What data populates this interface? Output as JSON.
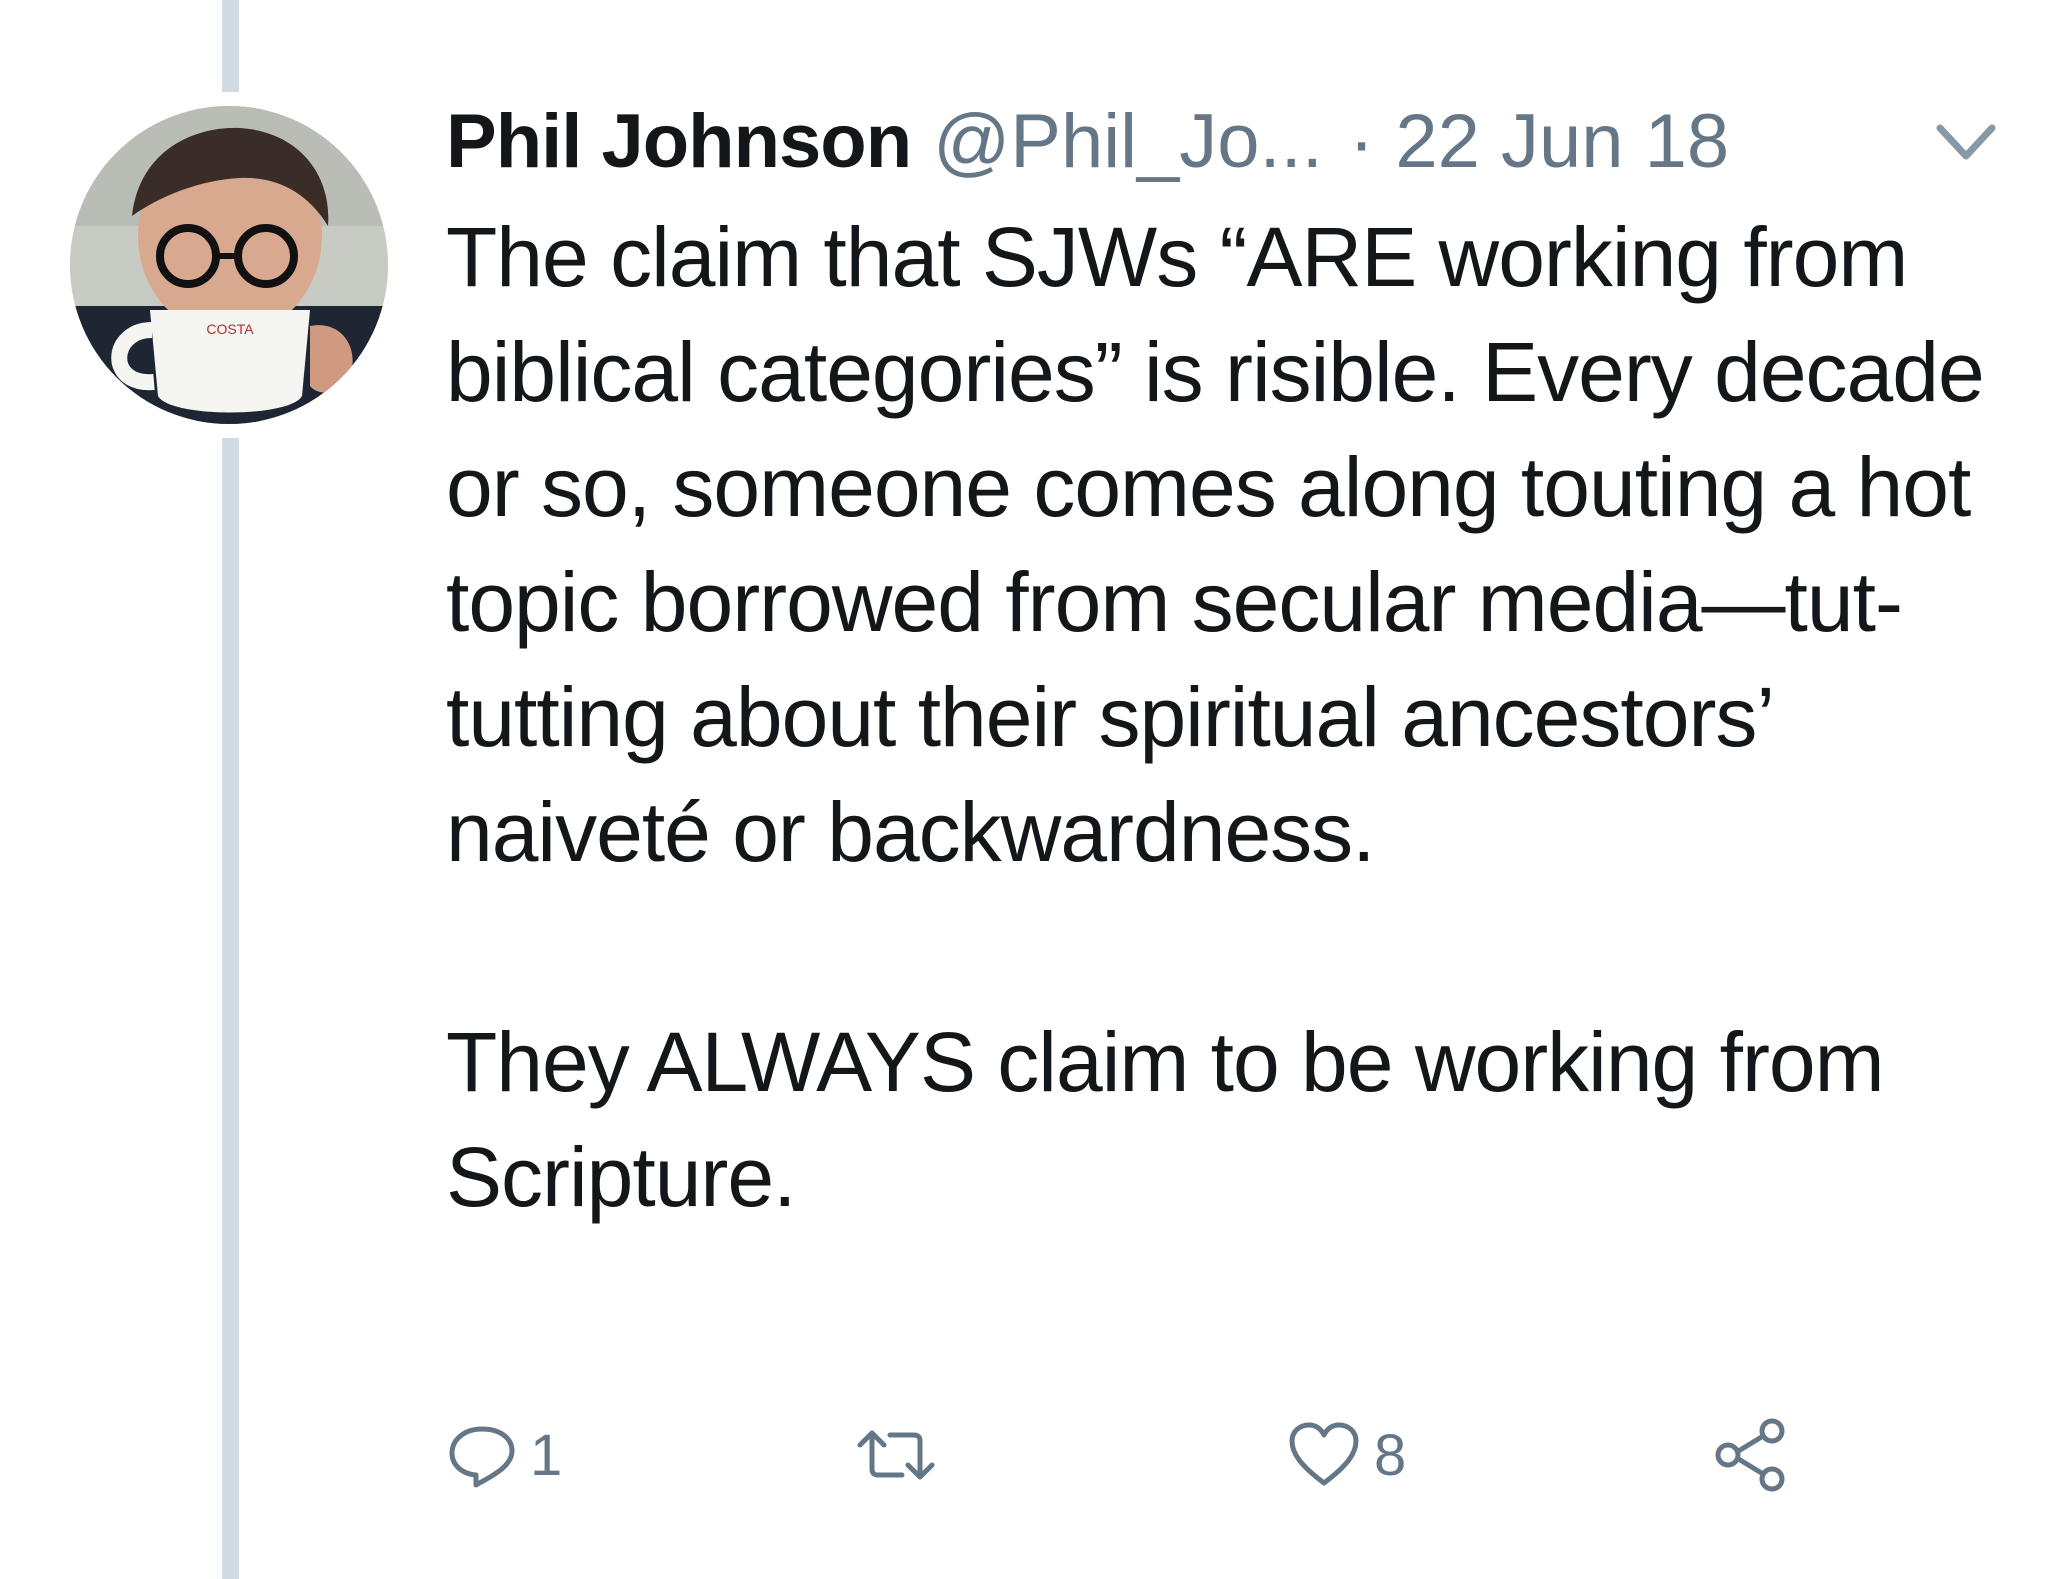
{
  "tweet": {
    "author_name": "Phil Johnson",
    "author_handle": "@Phil_Jo...",
    "date": "· 22 Jun 18",
    "paragraphs": [
      "The claim that SJWs “ARE working from biblical categories” is risible. Every decade or so, someone comes along touting a hot topic borrowed from secular media—tut-tutting about their spiritual ancestors’ naiveté or backwardness.",
      "They ALWAYS claim to be working from Scripture."
    ],
    "mug_text": "COSTA"
  },
  "actions": {
    "reply_count": "1",
    "retweet_count": "",
    "like_count": "8"
  },
  "icons": {
    "reply": "reply-icon",
    "retweet": "retweet-icon",
    "like": "heart-icon",
    "share": "share-icon",
    "caret": "chevron-down-icon"
  },
  "colors": {
    "text": "#14171a",
    "secondary": "#657786",
    "thread_line": "#d1dbe3"
  }
}
